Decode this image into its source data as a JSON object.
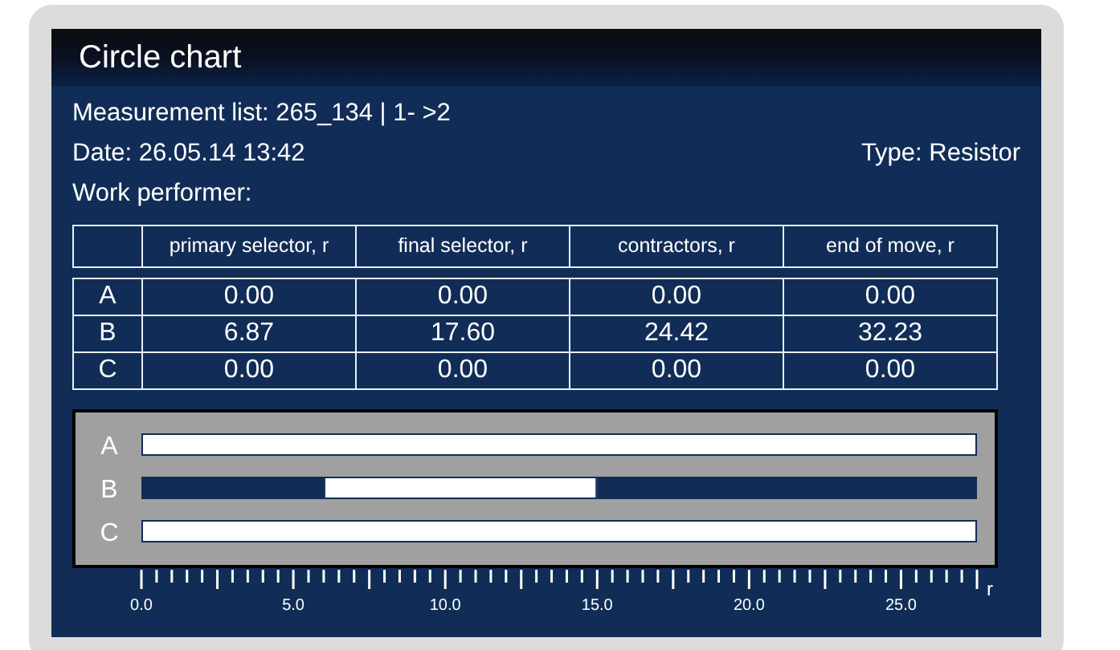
{
  "window": {
    "title": "Circle chart"
  },
  "info": {
    "measurement_list": "Measurement list: 265_134 | 1- >2",
    "date": "Date: 26.05.14 13:42",
    "type": "Type: Resistor",
    "work_performer": "Work performer:"
  },
  "table": {
    "columns": [
      "primary selector, r",
      "final selector, r",
      "contractors, r",
      "end of move, r"
    ],
    "rows": [
      {
        "label": "A",
        "cells": [
          "0.00",
          "0.00",
          "0.00",
          "0.00"
        ]
      },
      {
        "label": "B",
        "cells": [
          "6.87",
          "17.60",
          "24.42",
          "32.23"
        ]
      },
      {
        "label": "C",
        "cells": [
          "0.00",
          "0.00",
          "0.00",
          "0.00"
        ]
      }
    ]
  },
  "chart_data": {
    "type": "bar",
    "orientation": "horizontal",
    "xlabel": "r",
    "categories": [
      "A",
      "B",
      "C"
    ],
    "stacked": true,
    "series": [
      {
        "color": "#112d57",
        "values": [
          0,
          6.0,
          0
        ]
      },
      {
        "color": "#ffffff",
        "values": [
          27.5,
          9.0,
          27.5
        ]
      },
      {
        "color": "#112d57",
        "values": [
          0,
          12.5,
          0
        ]
      }
    ],
    "xlim": [
      0,
      27.5
    ],
    "xticks": [
      {
        "value": 0,
        "label": "0.0"
      },
      {
        "value": 5,
        "label": "5.0"
      },
      {
        "value": 10,
        "label": "10.0"
      },
      {
        "value": 15,
        "label": "15.0"
      },
      {
        "value": 20,
        "label": "20.0"
      },
      {
        "value": 25,
        "label": "25.0"
      }
    ]
  }
}
